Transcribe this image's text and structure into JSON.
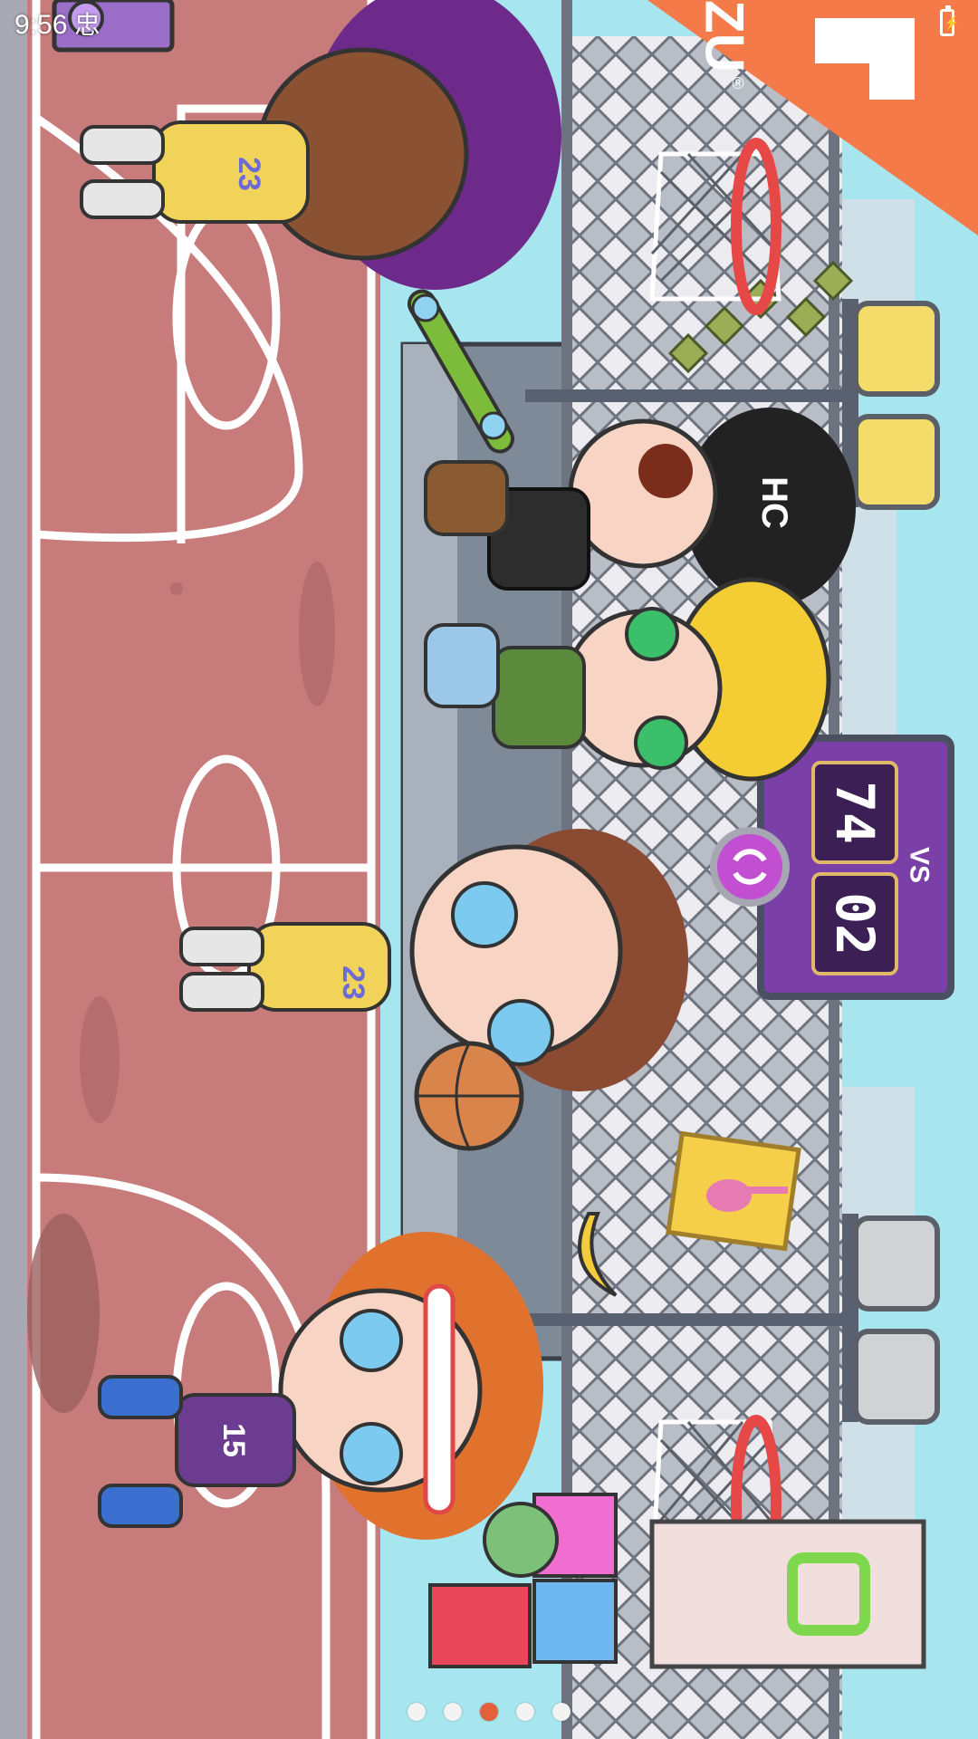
{
  "status_bar": {
    "time": "9:56",
    "notification_glyph": "忠"
  },
  "banner": {
    "brand_text": "ZU",
    "registered_mark": "®",
    "color": "#f47a4a"
  },
  "scoreboard": {
    "home_score": "74",
    "away_score": "02",
    "vs_label": "VS",
    "refresh_icon": "refresh-icon"
  },
  "characters": {
    "beanie_text": "HC",
    "jersey_top_left": "23",
    "jersey_center": "23",
    "jersey_bottom": "15"
  },
  "carousel": {
    "dots": 5,
    "active_index": 2
  },
  "colors": {
    "court": "#c77b7b",
    "sky": "#a8e6ef",
    "fence": "#8f9aa6",
    "accent_orange": "#f47a4a",
    "scoreboard": "#7b3fa8"
  }
}
